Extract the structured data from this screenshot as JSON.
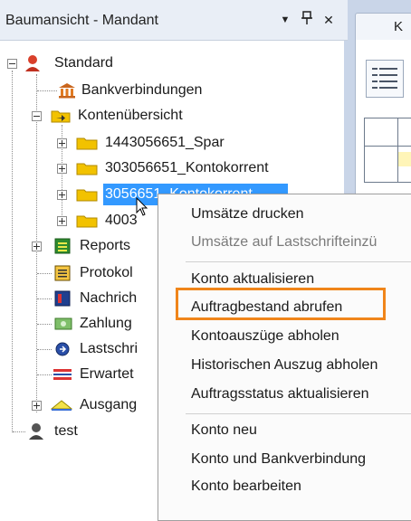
{
  "panel": {
    "title": "Baumansicht - Mandant",
    "dropdown_icon": "▼",
    "pin_icon": "ᵽ",
    "close_icon": "✕"
  },
  "right_pane": {
    "tab_label": "K"
  },
  "tree": {
    "root_label": "Standard",
    "items": [
      {
        "label": "Bankverbindungen"
      },
      {
        "label": "Kontenübersicht"
      },
      {
        "label": "1443056651_Spar"
      },
      {
        "label": "303056651_Kontokorrent"
      },
      {
        "label": "3056651_Kontokorrent"
      },
      {
        "label": "4003"
      },
      {
        "label": "Reports"
      },
      {
        "label": "Protokol"
      },
      {
        "label": "Nachrich"
      },
      {
        "label": "Zahlung"
      },
      {
        "label": "Lastschri"
      },
      {
        "label": "Erwartet"
      },
      {
        "label": "Ausgang"
      }
    ],
    "second_root_label": "test"
  },
  "context_menu": {
    "items": [
      {
        "label": "Umsätze drucken",
        "enabled": true
      },
      {
        "label": "Umsätze auf Lastschrifteinzü",
        "enabled": false
      },
      {
        "label": "Konto aktualisieren",
        "enabled": true
      },
      {
        "label": "Auftragbestand abrufen",
        "enabled": true,
        "highlighted": true
      },
      {
        "label": "Kontoauszüge abholen",
        "enabled": true
      },
      {
        "label": "Historischen Auszug abholen",
        "enabled": true
      },
      {
        "label": "Auftragsstatus aktualisieren",
        "enabled": true
      },
      {
        "label": "Konto neu",
        "enabled": true
      },
      {
        "label": "Konto und Bankverbindung",
        "enabled": true
      },
      {
        "label": "Konto bearbeiten",
        "enabled": true
      }
    ]
  },
  "colors": {
    "selection": "#3399ff",
    "highlight_box": "#f0851a",
    "folder": "#f2c200"
  }
}
